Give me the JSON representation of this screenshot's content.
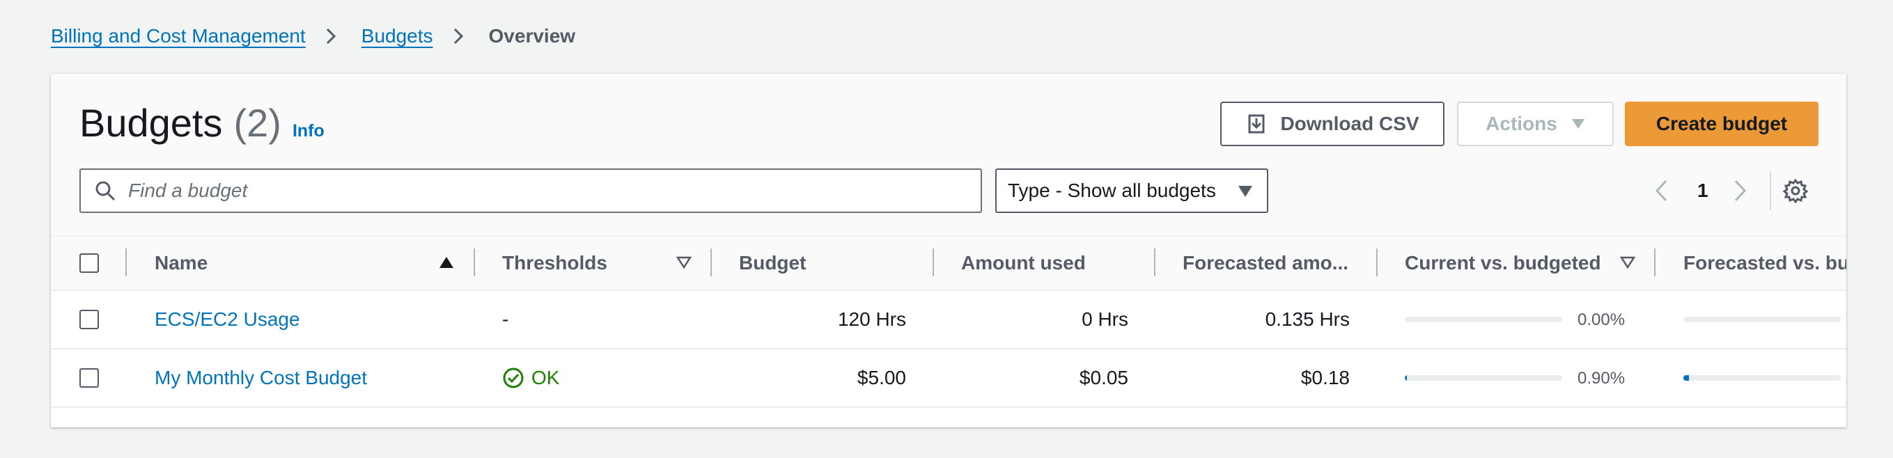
{
  "breadcrumb": {
    "items": [
      "Billing and Cost Management",
      "Budgets"
    ],
    "current": "Overview"
  },
  "header": {
    "title": "Budgets",
    "count": "(2)",
    "info": "Info"
  },
  "toolbar": {
    "download_label": "Download CSV",
    "actions_label": "Actions",
    "create_label": "Create budget"
  },
  "filters": {
    "search_placeholder": "Find a budget",
    "type_label": "Type - Show all budgets"
  },
  "pagination": {
    "current_page": "1"
  },
  "table": {
    "columns": [
      "Name",
      "Thresholds",
      "Budget",
      "Amount used",
      "Forecasted amo...",
      "Current vs. budgeted",
      "Forecasted vs. bud"
    ],
    "rows": [
      {
        "name": "ECS/EC2 Usage",
        "thresholds": "-",
        "budget": "120 Hrs",
        "amount_used": "0 Hrs",
        "forecasted": "0.135 Hrs",
        "current_vs_budgeted": "0.00%",
        "current_fraction": 0.0,
        "forecasted_fraction": 0.0
      },
      {
        "name": "My Monthly Cost Budget",
        "thresholds": "OK",
        "budget": "$5.00",
        "amount_used": "$0.05",
        "forecasted": "$0.18",
        "current_vs_budgeted": "0.90%",
        "current_fraction": 0.009,
        "forecasted_fraction": 0.036
      }
    ]
  },
  "colors": {
    "link": "#0073bb",
    "primary_button": "#ec9a37",
    "ok_status": "#1d8102",
    "progress": "#0073bb"
  }
}
